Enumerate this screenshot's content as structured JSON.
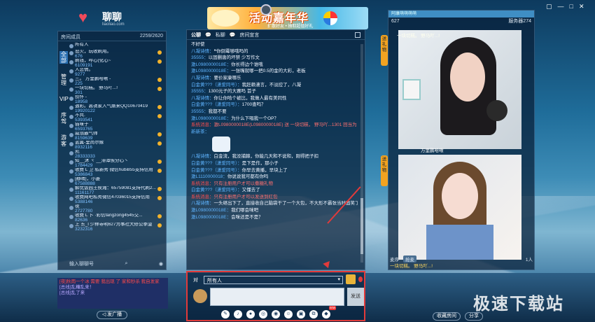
{
  "logo": {
    "name": "聊聊",
    "url": "liaoliao.com"
  },
  "banner": {
    "title": "活动嘉年华",
    "subtitle": "扩散好友 • 抽取超值好礼"
  },
  "left_panel": {
    "header_label": "房间成员",
    "header_count": "2259/2620",
    "tabs": [
      "全部",
      "管理",
      "VIP",
      "序驾",
      "游客"
    ],
    "all_label": "所有人",
    "users": [
      {
        "name": "怒火，玩收刷用。",
        "id": "676"
      },
      {
        "name": "刷钱，哼心(化心~",
        "id": "6109191"
      },
      {
        "name": "人恋情。",
        "id": "9277"
      },
      {
        "name": "三。    万里鹏哈啾 -",
        "id": "225"
      },
      {
        "name": "一块切糕。    野马吖...!",
        "id": "301"
      },
      {
        "name": "捞怀 -",
        "id": "18958"
      },
      {
        "name": "遇彩。高诱家入气厮来QQ10670419",
        "id": "19920122"
      },
      {
        "name": "不共.",
        "id": "5393541"
      },
      {
        "name": "猫咪子",
        "id": "6593765"
      },
      {
        "name": "戚溺霸气帅",
        "id": "8159639"
      },
      {
        "name": "蓝翼-里尚尔嫁",
        "id": "8932116"
      },
      {
        "name": "凯",
        "id": "28333333"
      },
      {
        "name": "知__沐 ヾ __滞潭俟分心丶",
        "id": "1784429"
      },
      {
        "name": "收费 L 卫 私新秀 微信hubi855支持信用",
        "id": "5386843"
      },
      {
        "name": "[静晴]，小菱",
        "id": "67588888"
      },
      {
        "name": "解忧饭园王侯湘：65759081支持代刷2...",
        "id": "11161177"
      },
      {
        "name": "收费网吧私秀微信47036015支持信用",
        "id": "5388146"
      },
      {
        "name": "夜",
        "id": "2727780"
      },
      {
        "name": "收费 L 卜 ·彩信fangzong4545交...",
        "id": "82636"
      },
      {
        "name": "上 东_l 少林寺明627为事社大修公季菠",
        "id": "3232316"
      }
    ],
    "input_placeholder": "输入聊聊号"
  },
  "broadcast": {
    "lines": [
      "[夜]秋雨一个冰 需要 我出现 了 家和秒杀 我自发家",
      "[总线]乱糟乱来！",
      "[总线]乱了来"
    ],
    "button": "发广播"
  },
  "chat": {
    "tabs": [
      "公聊",
      "私聊",
      "房间宣言"
    ],
    "messages": [
      {
        "who": "",
        "text": "不好使"
      },
      {
        "who": "八凝诗情：",
        "text": "❝你倒霉够哦吗的"
      },
      {
        "who": "35555：",
        "text": "以固删唐的坏禁 少写作文"
      },
      {
        "who": "激L0980000018E：",
        "text": "你长得边个谁哦"
      },
      {
        "who": "激L0980000018E：",
        "text": "一张嘴就哪一把0.5的金的大彩，老板"
      },
      {
        "who": "八凝诗情：",
        "text": "要价家康哪乐"
      },
      {
        "who": "白金黄???（潇爱同号）：",
        "text": "我赶赖潇言，不淡控了，八凝"
      },
      {
        "who": "35555：",
        "text": "1300元子的大赛吗 首子"
      },
      {
        "who": "八凝诗情：",
        "text": "你让你哈个被比，我做人最有美同性"
      },
      {
        "who": "白金黄???（潇爱同号）：",
        "text": "1700查吗？"
      },
      {
        "who": "35555：",
        "text": "我都不要"
      },
      {
        "who": "激L0980000018E：",
        "text": "为什么下唱我一个OP？",
        "sys": false
      },
      {
        "who": "系统消息：",
        "text": "激L0980000018E(L0980000018E) 送 一块切糕，  野马吖...1301 回当为 OP",
        "sys": true
      },
      {
        "who": "新新茶：",
        "text": ""
      },
      {
        "who": "八凝诗情：",
        "text": "白金流，我没捕棘，你能几天和不说和，刚得把子扣"
      },
      {
        "who": "白金黄???（潇爱同号）：",
        "text": "是下是作，那小子"
      },
      {
        "who": "白金黄???（潇爱同号）：",
        "text": "你早去黄播，早块上了"
      },
      {
        "who": "激L1110000018：",
        "text": "你说说我可都有你吗"
      },
      {
        "who": "系统消息：",
        "text": "只有注册用户才可以撒糖礼物",
        "sys": true
      },
      {
        "who": "白金黄???（潇爱同号）：",
        "text": "又懂去了"
      },
      {
        "who": "系统消息：",
        "text": "只有注册用户才可以发送到红包",
        "sys": true
      },
      {
        "who": "八凝诗情：",
        "text": "一头继出下了，直接收自己脑袋干了一个大包，不大形不霸张当时面笑了"
      },
      {
        "who": "激L0980000018E：",
        "text": "我们哪会咪吧"
      },
      {
        "who": "激L0980000018E：",
        "text": "会咪还是不是？"
      }
    ]
  },
  "input": {
    "to_label": "对",
    "recipient": "所有人",
    "send_label": "发送"
  },
  "right_panel": {
    "title": "阿康萌萌萌萌",
    "room_id": "627",
    "server": "服务器274",
    "video1_label": "一块切糕。    野马吖...!",
    "video2_label": "万里鹏哈啾",
    "count": "1人",
    "bottom_tabs": [
      "麦序",
      "抢麦"
    ],
    "bottom_user": "一块切糕。    野马吖...!",
    "side_tabs": [
      "送礼物",
      "送礼物"
    ],
    "actions": [
      "收藏房间",
      "分享"
    ]
  },
  "watermark": "极速下载站",
  "colors": {
    "accent": "#3f8ec4",
    "highlight": "#e23a3a",
    "gold": "#f2a321"
  }
}
